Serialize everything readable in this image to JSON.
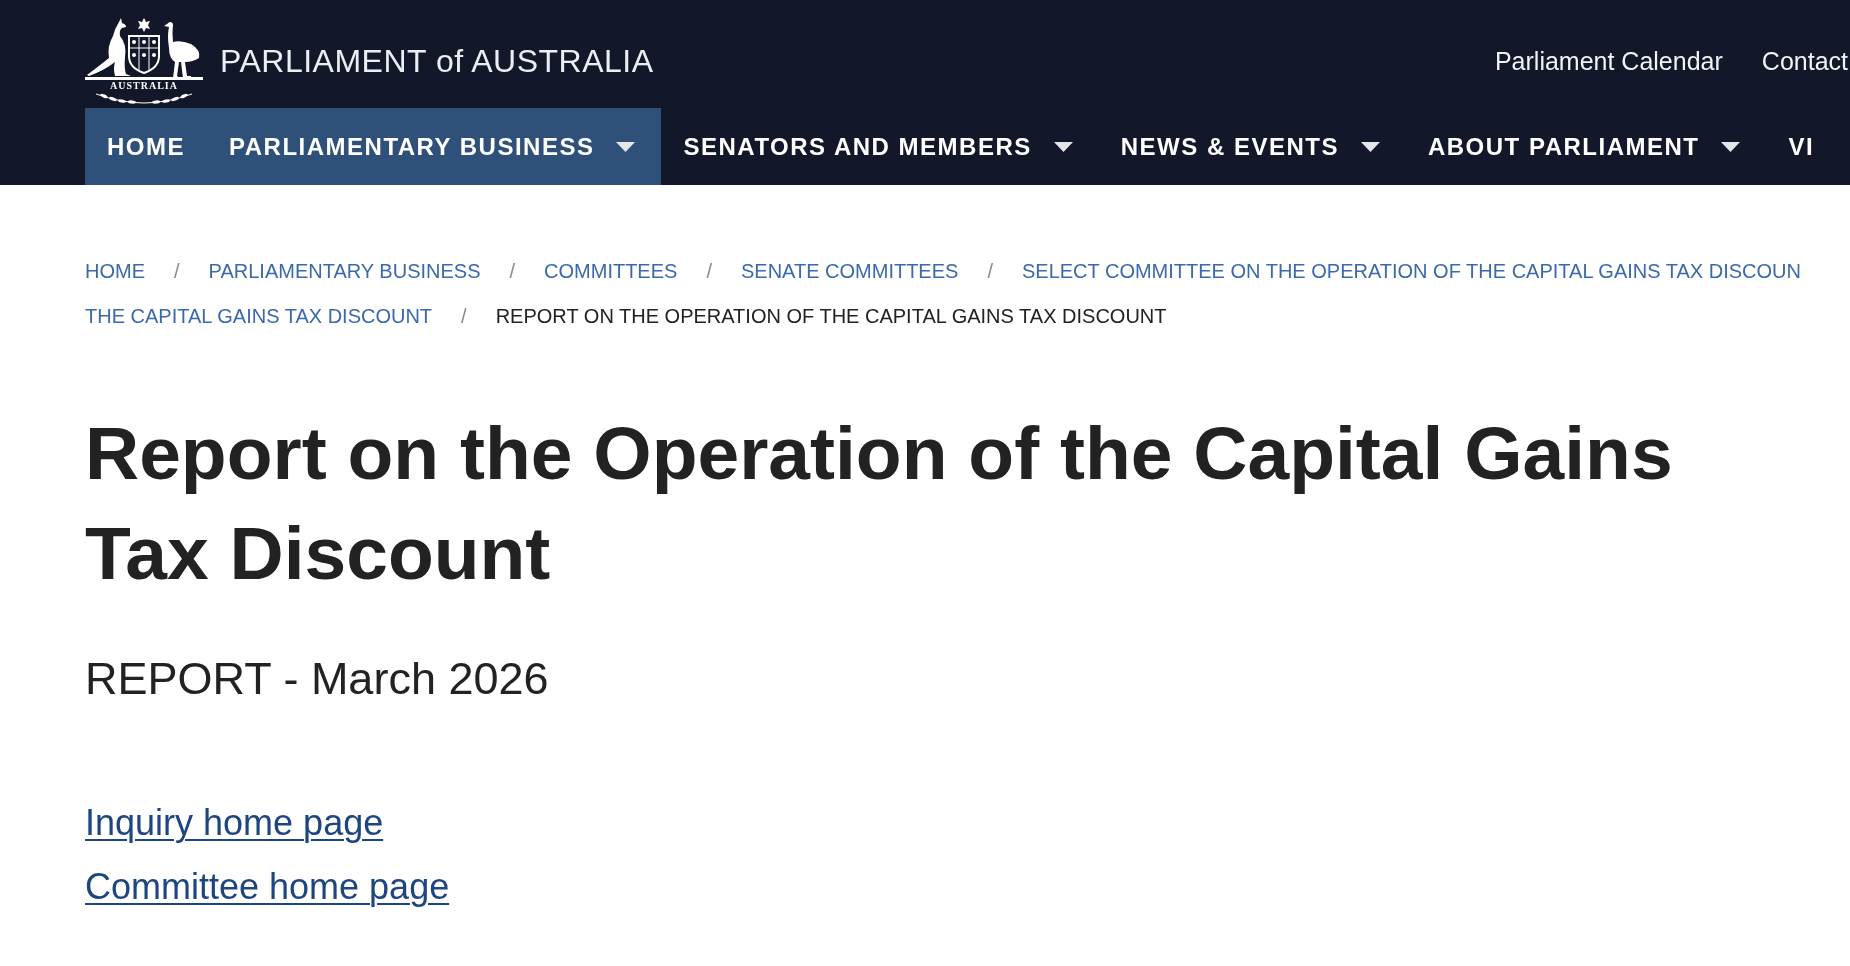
{
  "header": {
    "emblem": {
      "motto": "AUSTRALIA"
    },
    "site_title": "PARLIAMENT of AUSTRALIA",
    "top_links": [
      "Parliament Calendar",
      "Contact"
    ]
  },
  "nav": [
    {
      "label": "HOME",
      "selected": true,
      "dropdown": false
    },
    {
      "label": "PARLIAMENTARY BUSINESS",
      "selected": true,
      "dropdown": true
    },
    {
      "label": "SENATORS AND MEMBERS",
      "selected": false,
      "dropdown": true
    },
    {
      "label": "NEWS & EVENTS",
      "selected": false,
      "dropdown": true
    },
    {
      "label": "ABOUT PARLIAMENT",
      "selected": false,
      "dropdown": true
    },
    {
      "label": "VI",
      "selected": false,
      "dropdown": false
    }
  ],
  "breadcrumb": [
    {
      "label": "HOME",
      "current": false
    },
    {
      "separator": "/",
      "label": "PARLIAMENTARY BUSINESS",
      "current": false
    },
    {
      "separator": "/",
      "label": "COMMITTEES",
      "current": false
    },
    {
      "separator": "/",
      "label": "SENATE COMMITTEES",
      "current": false
    },
    {
      "separator": "/",
      "label": "SELECT COMMITTEE ON THE OPERATION OF THE CAPITAL GAINS TAX DISCOUN",
      "current": false
    },
    {
      "label": "THE CAPITAL GAINS TAX DISCOUNT",
      "current": false
    },
    {
      "separator": "/",
      "label": "REPORT ON THE OPERATION OF THE CAPITAL GAINS TAX DISCOUNT",
      "current": true
    }
  ],
  "page": {
    "title": "Report on the Operation of the Capital Gains Tax Discount",
    "subtitle": "REPORT - March 2026",
    "links": [
      "Inquiry home page",
      "Committee home page"
    ]
  }
}
